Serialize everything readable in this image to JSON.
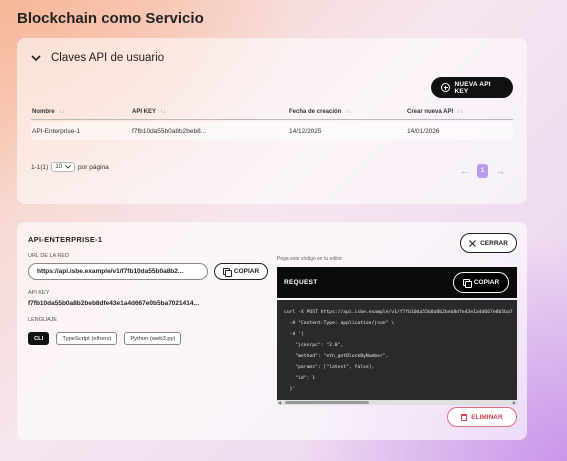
{
  "page": {
    "title": "Blockchain como Servicio"
  },
  "keys_section": {
    "title": "Claves API de usuario",
    "new_key_label": "NUEVA API KEY",
    "columns": [
      "Nombre",
      "API KEY",
      "Fecha de creación",
      "Crear nueva API"
    ],
    "rows": [
      {
        "name": "API-Enterprise-1",
        "api_key": "f7fb10da55b0a8b2beb8...",
        "created": "14/12/2025",
        "renew": "14/01/2026"
      }
    ],
    "pagination": {
      "range": "1-1(1)",
      "per_page": "10",
      "per_page_label": "por página",
      "current_page": "1",
      "prev": "←",
      "next": "→"
    }
  },
  "detail": {
    "title": "API-ENTERPRISE-1",
    "close_label": "CERRAR",
    "network_url_label": "URL DE LA RED",
    "network_url": "https://api.isbe.example/v1/f7fb10da55b0a8b2...",
    "copy_label": "COPIAR",
    "api_key_label": "API KEY",
    "api_key": "f7fb10da55b0a8b2beb8dfe43e1a4d667e0b5ba7021414...",
    "language_label": "LENGUAJE",
    "languages": [
      "CLI",
      "TypeScript (ethers)",
      "Python (web3.py)"
    ],
    "active_language": "CLI",
    "code_hint": "Pega este código en tu editor",
    "request_label": "REQUEST",
    "copy_code_label": "COPIAR",
    "code_lines": [
      "curl -X POST https://api.isbe.example/v1/f7fb10da55b0a8b2beb8dfe43e1a4d667e0b5ba7",
      "  -H \"Content-Type: application/json\" \\",
      "  -d '{",
      "    \"jsonrpc\": \"2.0\",",
      "    \"method\": \"eth_getBlockByNumber\",",
      "    \"params\": [\"latest\", false],",
      "    \"id\": 1",
      "  }'"
    ],
    "delete_label": "ELIMINAR"
  }
}
